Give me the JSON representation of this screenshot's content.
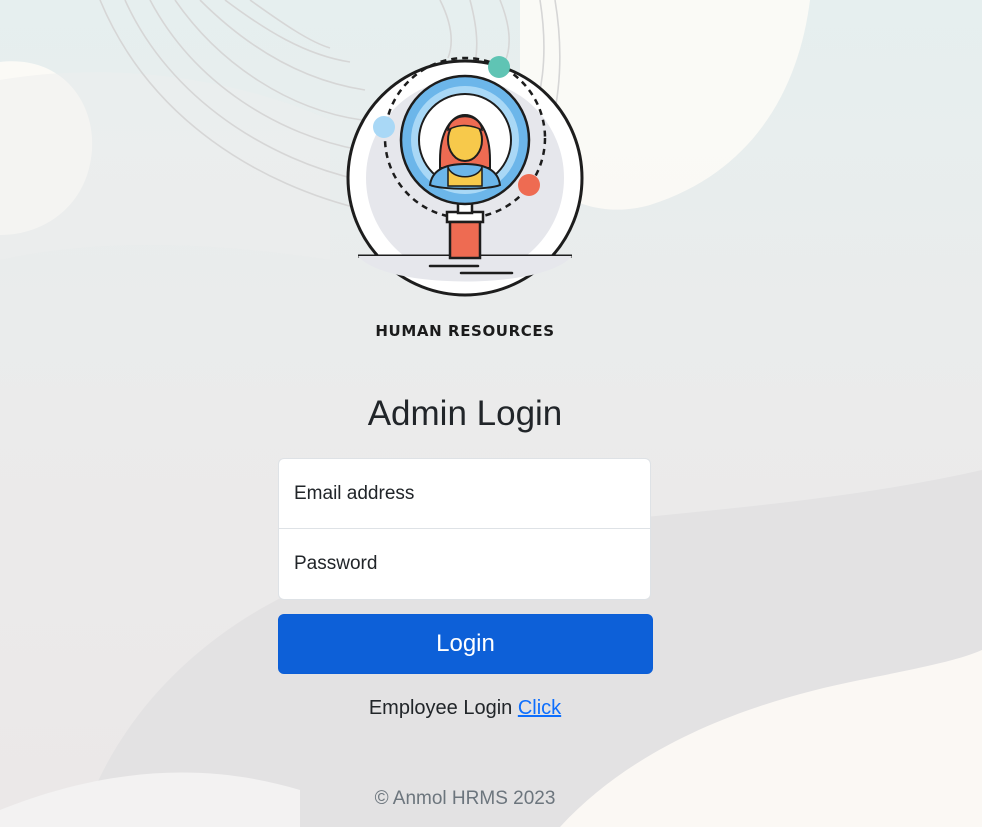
{
  "brand": {
    "name": "HUMAN RESOURCES",
    "logo_icon": "hr-magnifier-person-icon"
  },
  "login": {
    "title": "Admin Login",
    "email_placeholder": "Email address",
    "password_placeholder": "Password",
    "submit_label": "Login",
    "employee_prefix": "Employee Login",
    "employee_link": "Click"
  },
  "footer": {
    "text": "© Anmol HRMS 2023"
  },
  "colors": {
    "primary": "#0d60d8",
    "link": "#0d6efd",
    "background": "#ecebeb",
    "accent_teal": "#5fc4b4",
    "accent_red": "#ee6b52",
    "accent_blue": "#6cb6ea"
  }
}
